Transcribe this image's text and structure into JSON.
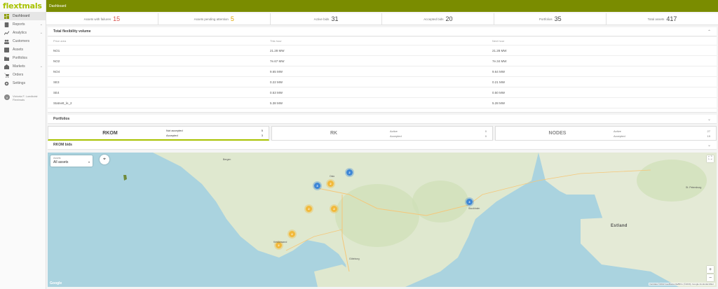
{
  "app": {
    "logo": "flextmals"
  },
  "topbar": {
    "title": "Dashboard"
  },
  "sidebar": {
    "items": [
      {
        "label": "Dashboard",
        "icon": "dashboard-icon",
        "active": true
      },
      {
        "label": "Reports",
        "icon": "reports-icon",
        "chevron": "⌄"
      },
      {
        "label": "Analytics",
        "icon": "analytics-icon",
        "chevron": "⌄"
      },
      {
        "label": "Customers",
        "icon": "customers-icon"
      },
      {
        "label": "Assets",
        "icon": "assets-icon"
      },
      {
        "label": "Portfolios",
        "icon": "portfolios-icon"
      },
      {
        "label": "Markets",
        "icon": "markets-icon",
        "chevron": "⌄"
      },
      {
        "label": "Orders",
        "icon": "orders-icon"
      },
      {
        "label": "Settings",
        "icon": "settings-icon"
      }
    ],
    "user": {
      "initial": "V",
      "name": "Victoria F. Lundkvist",
      "org": "Flextmals"
    }
  },
  "stats": [
    {
      "label": "Assets with failures",
      "value": "15",
      "color": "#d9534f"
    },
    {
      "label": "Assets pending attention",
      "value": "5",
      "color": "#e0a800"
    },
    {
      "label": "Active bids",
      "value": "31",
      "color": "#444444"
    },
    {
      "label": "Accepted bids",
      "value": "20",
      "color": "#444444"
    },
    {
      "label": "Portfolios",
      "value": "35",
      "color": "#444444"
    },
    {
      "label": "Total assets",
      "value": "417",
      "color": "#444444"
    }
  ],
  "flex_panel": {
    "title": "Total flexibility volume",
    "chevron": "⌃",
    "columns": [
      "Price area",
      "This hour",
      "Next hour"
    ],
    "rows": [
      [
        "NO1",
        "21.28 MW",
        "21.28 MW"
      ],
      [
        "NO2",
        "7e.67 MW",
        "7e.34 MW"
      ],
      [
        "NO4",
        "9.65 MW",
        "9.64 MW"
      ],
      [
        "SE3",
        "0.22 MW",
        "0.21 MW"
      ],
      [
        "SE4",
        "0.53 MW",
        "0.50 MW"
      ],
      [
        "Statnett_le_2",
        "5.38 MW",
        "5.28 MW"
      ]
    ]
  },
  "portfolios_panel": {
    "title": "Portfolios",
    "chevron": "⌄"
  },
  "cards": [
    {
      "name": "RKOM",
      "rows": [
        [
          "Not accepted",
          "5"
        ],
        [
          "Accepted",
          "3"
        ]
      ],
      "selected": true
    },
    {
      "name": "RK",
      "rows": [
        [
          "Active",
          "0"
        ],
        [
          "Accepted",
          "0"
        ]
      ],
      "selected": false
    },
    {
      "name": "NODES",
      "rows": [
        [
          "Active",
          "27"
        ],
        [
          "Accepted",
          "19"
        ]
      ],
      "selected": false
    }
  ],
  "bids_panel": {
    "title": "RKOM bids",
    "chevron": "⌄"
  },
  "map": {
    "filter_label": "Assets",
    "filter_value": "All assets",
    "filter_arrow": "▾",
    "locate_icon": "⌖",
    "fullscreen_icon": "⛶",
    "zoom_in": "+",
    "zoom_out": "−",
    "clusters": [
      {
        "label": "2",
        "color": "blue"
      },
      {
        "label": "3",
        "color": "blue"
      },
      {
        "label": "2",
        "color": "orange"
      },
      {
        "label": "2",
        "color": "orange"
      },
      {
        "label": "2",
        "color": "orange"
      },
      {
        "label": "3",
        "color": "blue"
      },
      {
        "label": "2",
        "color": "orange"
      },
      {
        "label": "2",
        "color": "orange"
      }
    ],
    "labels": {
      "bergen": "Bergen",
      "oslo": "Oslo",
      "stockholm": "Stockholm",
      "estland": "Estland",
      "goteborg": "Göteborg",
      "kristiansand": "Kristiansand",
      "petersburg": "St. Petersburg"
    },
    "attribution": "Kartdata ©2022 GeoBasis-DE/BKG (©2009), Google   Användarvillkor",
    "google": "Google"
  }
}
